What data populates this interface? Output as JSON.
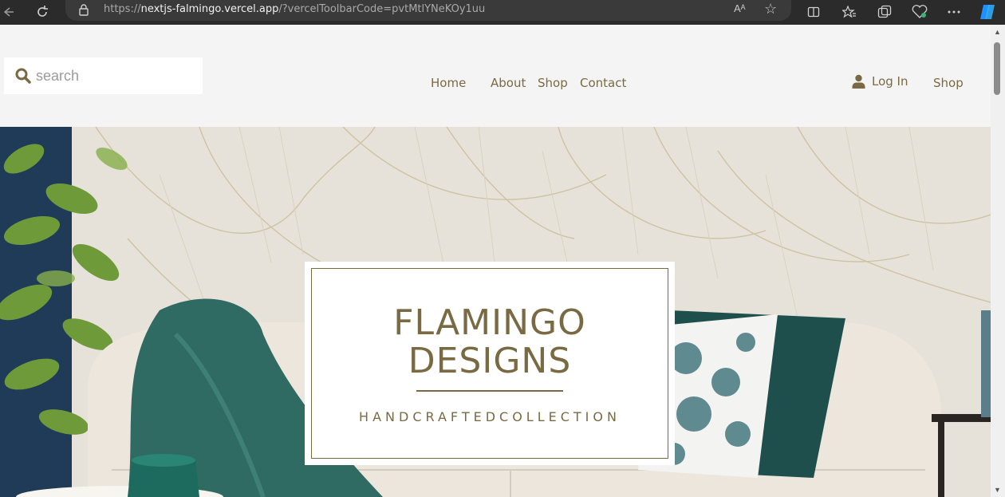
{
  "browser": {
    "url_prefix": "https://",
    "url_host": "nextjs-falmingo.vercel.app",
    "url_rest": "/?vercelToolbarCode=pvtMtlYNeKOy1uu",
    "icons": [
      "back-icon",
      "refresh-icon",
      "lock-icon",
      "read-aloud-icon",
      "favorite-star-icon",
      "split-screen-icon",
      "favorites-icon",
      "collections-icon",
      "browser-essentials-icon",
      "more-icon",
      "copilot-icon"
    ],
    "read_aloud_label": "Aᴬ"
  },
  "header": {
    "search": {
      "placeholder": "search",
      "value": ""
    },
    "nav": [
      {
        "label": "Home"
      },
      {
        "label": "About"
      },
      {
        "label": "Shop"
      },
      {
        "label": "Contact"
      }
    ],
    "login_label": "Log In",
    "shop_label": "Shop"
  },
  "hero": {
    "brand_line1": "FLAMINGO",
    "brand_line2": "DESIGNS",
    "tagline": "HANDCRAFTEDCOLLECTION"
  },
  "colors": {
    "brand": "#7a6a44",
    "header_bg": "#f4f4f4",
    "chrome_bg": "#2b2b2b"
  }
}
